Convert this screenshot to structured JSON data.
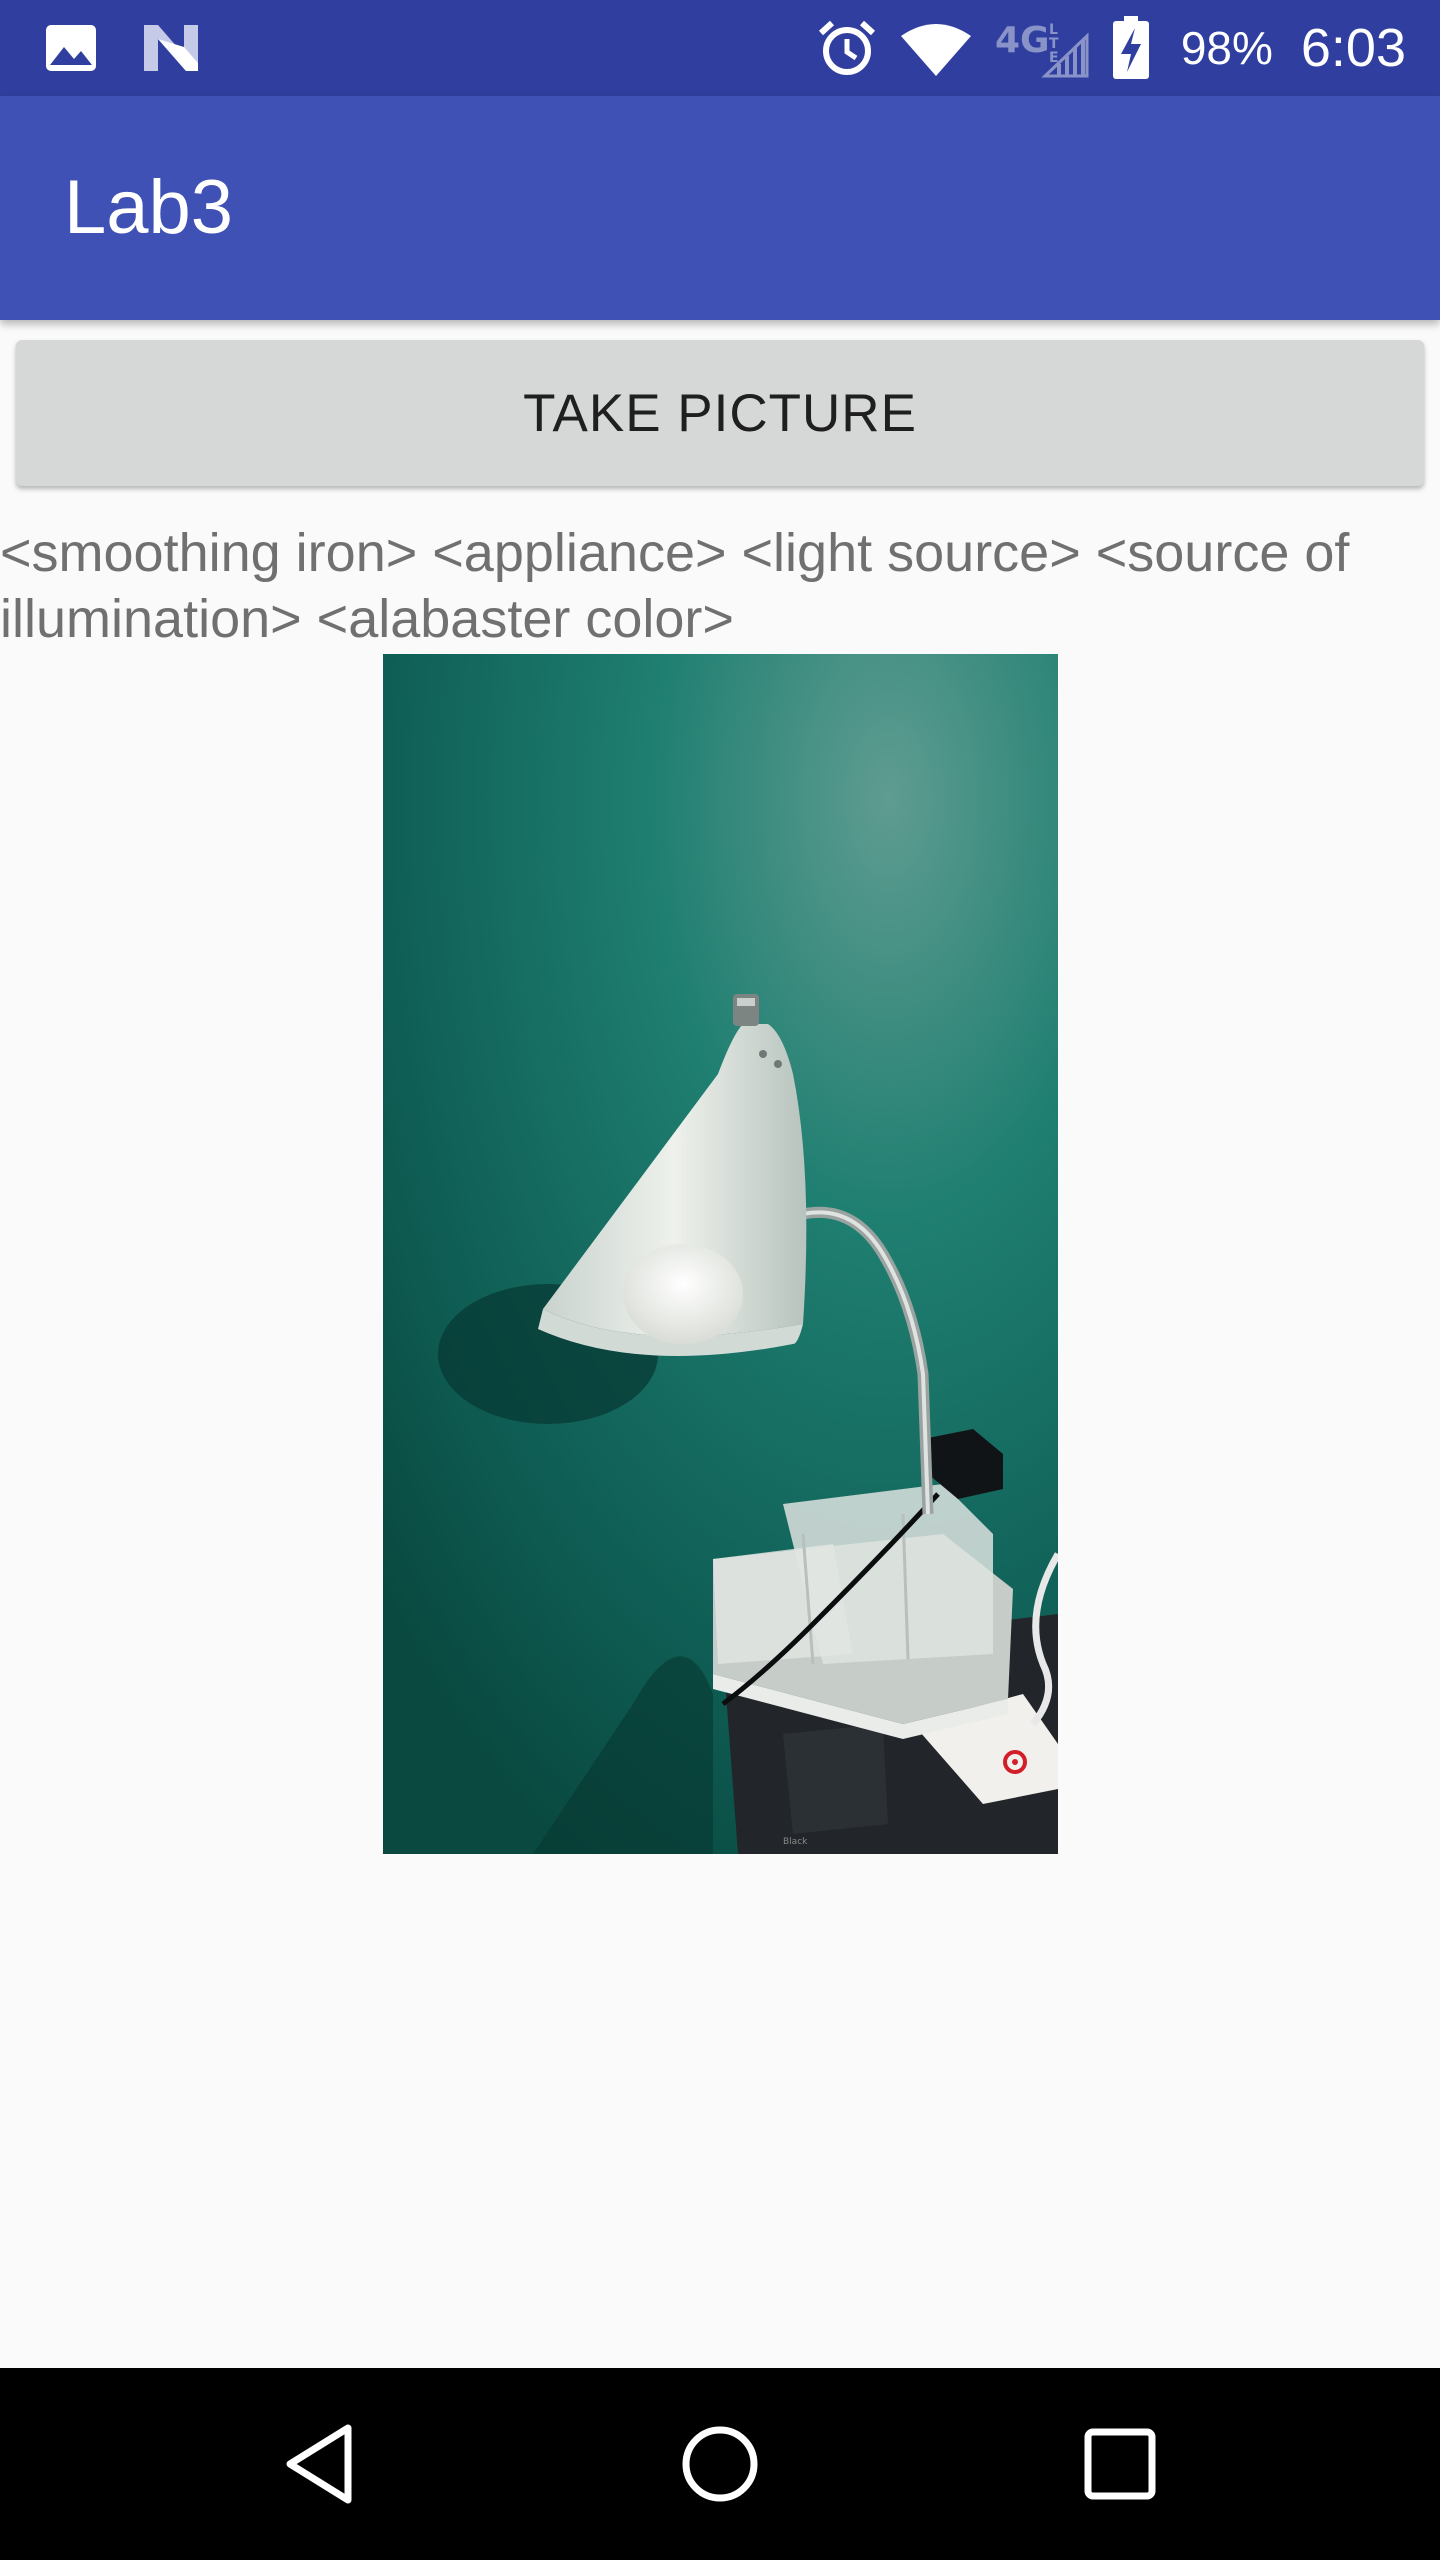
{
  "status_bar": {
    "left_icons": [
      "gallery-icon",
      "n-logo-icon"
    ],
    "right_icons": [
      "alarm-icon",
      "wifi-icon",
      "4g-lte-icon",
      "signal-icon",
      "battery-charging-icon"
    ],
    "battery": "98%",
    "time": "6:03"
  },
  "app_bar": {
    "title": "Lab3"
  },
  "main": {
    "take_picture_label": "TAKE PICTURE",
    "labels_text": "<smoothing iron> <appliance> <light source> <source of illumination> <alabaster color>"
  },
  "nav_bar": {
    "icons": [
      "back-icon",
      "home-icon",
      "recents-icon"
    ]
  },
  "colors": {
    "status_bar": "#303f9f",
    "app_bar": "#3f51b5",
    "background": "#fafafa",
    "button": "#d6d7d7",
    "label_text": "#707070"
  }
}
